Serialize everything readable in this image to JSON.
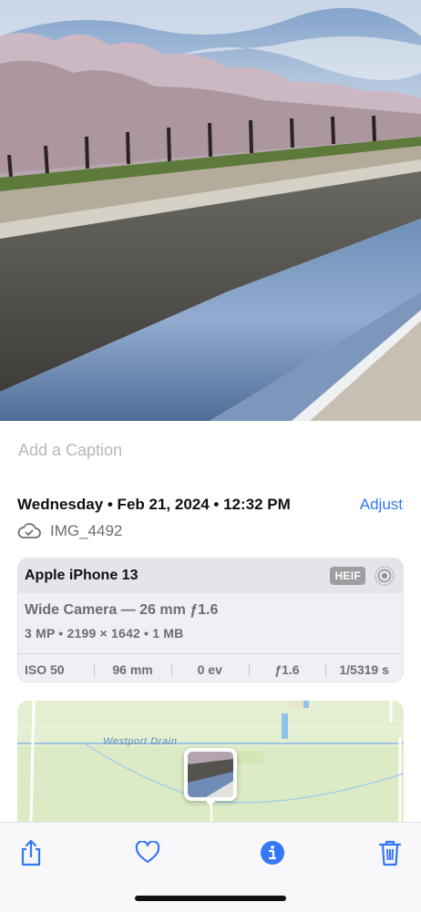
{
  "caption": {
    "placeholder": "Add a Caption",
    "value": ""
  },
  "info": {
    "date_line": "Wednesday • Feb 21, 2024 • 12:32 PM",
    "adjust_label": "Adjust",
    "file_name": "IMG_4492",
    "cloud_icon": "cloud-check-icon"
  },
  "device": {
    "name": "Apple iPhone 13",
    "format_badge": "HEIF",
    "live_icon": "live-photo-icon",
    "lens": "Wide Camera — 26 mm ƒ1.6",
    "specs": "3 MP  •  2199 × 1642  •  1 MB",
    "exif": {
      "iso": "ISO 50",
      "focal": "96 mm",
      "ev": "0 ev",
      "aperture": "ƒ1.6",
      "shutter": "1/5319 s"
    }
  },
  "map": {
    "label": "Westport Drain"
  },
  "toolbar": {
    "share_icon": "share-icon",
    "favorite_icon": "heart-icon",
    "info_icon": "info-icon",
    "delete_icon": "trash-icon",
    "accent": "#3478f6"
  }
}
